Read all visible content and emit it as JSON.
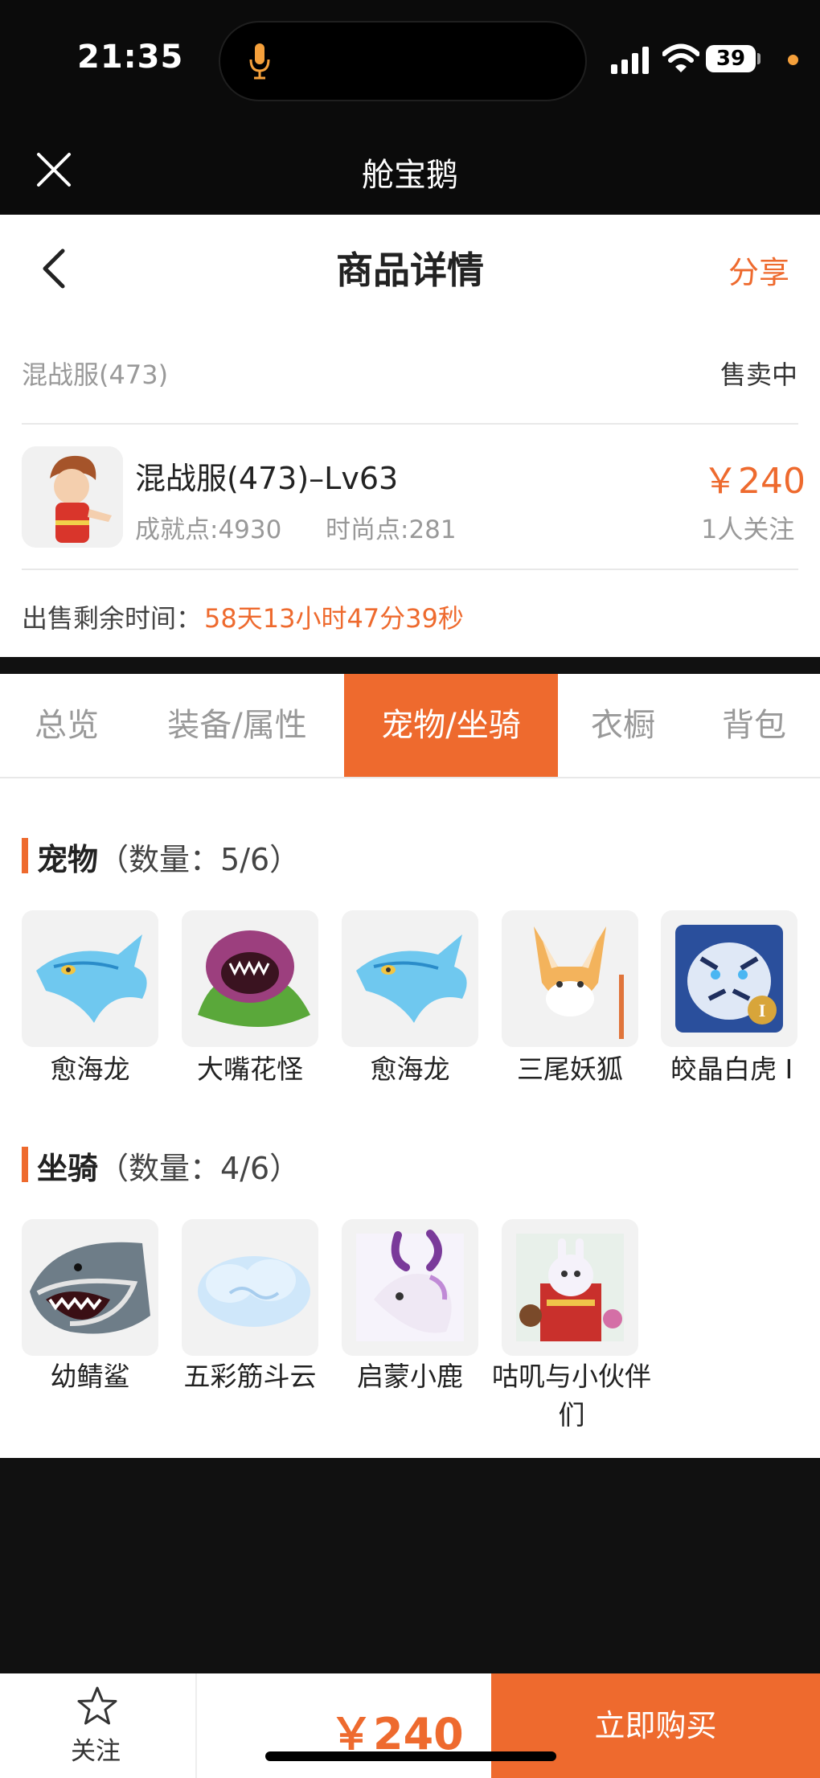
{
  "status_bar": {
    "time": "21:35",
    "battery": "39"
  },
  "app_bar": {
    "title": "舱宝鹅"
  },
  "header": {
    "title": "商品详情",
    "share_label": "分享"
  },
  "listing": {
    "server": "混战服(473)",
    "status": "售卖中",
    "role_name": "混战服(473)–Lv63",
    "achievement": "成就点:4930",
    "fashion": "时尚点:281",
    "price": "￥240",
    "followers": "1人关注",
    "remaining_label": "出售剩余时间：",
    "remaining_value": "58天13小时47分39秒"
  },
  "tabs": [
    {
      "label": "总览",
      "active": false
    },
    {
      "label": "装备/属性",
      "active": false
    },
    {
      "label": "宠物/坐骑",
      "active": true
    },
    {
      "label": "衣橱",
      "active": false
    },
    {
      "label": "背包",
      "active": false
    }
  ],
  "pets": {
    "title": "宠物",
    "count": "（数量：5/6）",
    "items": [
      {
        "name": "愈海龙",
        "icon": "blue-dragon-icon"
      },
      {
        "name": "大嘴花怪",
        "icon": "flower-monster-icon"
      },
      {
        "name": "愈海龙",
        "icon": "blue-dragon-icon"
      },
      {
        "name": "三尾妖狐",
        "icon": "fox-icon"
      },
      {
        "name": "皎晶白虎 I",
        "icon": "white-tiger-icon"
      }
    ]
  },
  "mounts": {
    "title": "坐骑",
    "count": "（数量：4/6）",
    "items": [
      {
        "name": "幼鲭鲨",
        "icon": "shark-icon"
      },
      {
        "name": "五彩筋斗云",
        "icon": "cloud-icon"
      },
      {
        "name": "启蒙小鹿",
        "icon": "deer-icon"
      },
      {
        "name": "咕叽与小伙伴们",
        "icon": "rabbit-friends-icon"
      }
    ]
  },
  "bottom_bar": {
    "follow_label": "关注",
    "price": "￥240",
    "buy_label": "立即购买"
  },
  "colors": {
    "accent": "#ee6a2e",
    "dark_bg": "#111111"
  }
}
